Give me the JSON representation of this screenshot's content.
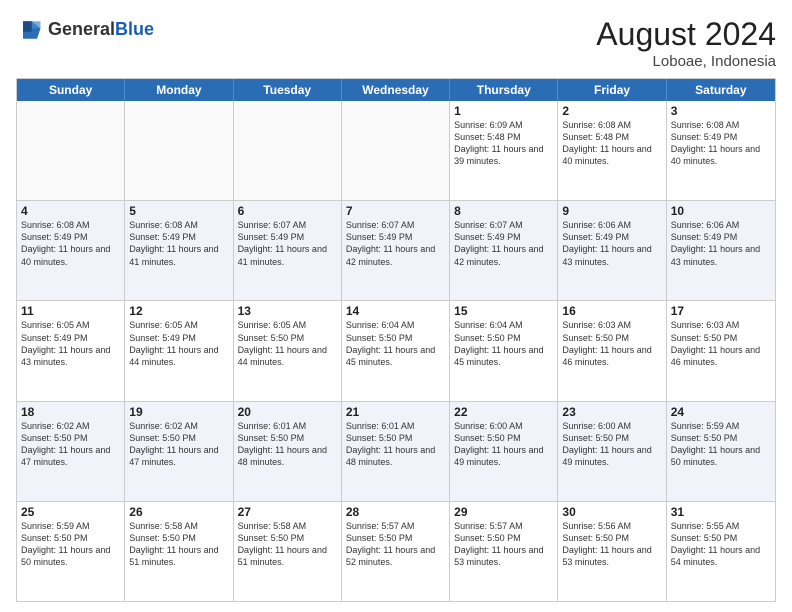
{
  "header": {
    "logo_general": "General",
    "logo_blue": "Blue",
    "month_year": "August 2024",
    "location": "Loboae, Indonesia"
  },
  "days_of_week": [
    "Sunday",
    "Monday",
    "Tuesday",
    "Wednesday",
    "Thursday",
    "Friday",
    "Saturday"
  ],
  "weeks": [
    [
      {
        "day": "",
        "detail": ""
      },
      {
        "day": "",
        "detail": ""
      },
      {
        "day": "",
        "detail": ""
      },
      {
        "day": "",
        "detail": ""
      },
      {
        "day": "1",
        "detail": "Sunrise: 6:09 AM\nSunset: 5:48 PM\nDaylight: 11 hours\nand 39 minutes."
      },
      {
        "day": "2",
        "detail": "Sunrise: 6:08 AM\nSunset: 5:48 PM\nDaylight: 11 hours\nand 40 minutes."
      },
      {
        "day": "3",
        "detail": "Sunrise: 6:08 AM\nSunset: 5:49 PM\nDaylight: 11 hours\nand 40 minutes."
      }
    ],
    [
      {
        "day": "4",
        "detail": "Sunrise: 6:08 AM\nSunset: 5:49 PM\nDaylight: 11 hours\nand 40 minutes."
      },
      {
        "day": "5",
        "detail": "Sunrise: 6:08 AM\nSunset: 5:49 PM\nDaylight: 11 hours\nand 41 minutes."
      },
      {
        "day": "6",
        "detail": "Sunrise: 6:07 AM\nSunset: 5:49 PM\nDaylight: 11 hours\nand 41 minutes."
      },
      {
        "day": "7",
        "detail": "Sunrise: 6:07 AM\nSunset: 5:49 PM\nDaylight: 11 hours\nand 42 minutes."
      },
      {
        "day": "8",
        "detail": "Sunrise: 6:07 AM\nSunset: 5:49 PM\nDaylight: 11 hours\nand 42 minutes."
      },
      {
        "day": "9",
        "detail": "Sunrise: 6:06 AM\nSunset: 5:49 PM\nDaylight: 11 hours\nand 43 minutes."
      },
      {
        "day": "10",
        "detail": "Sunrise: 6:06 AM\nSunset: 5:49 PM\nDaylight: 11 hours\nand 43 minutes."
      }
    ],
    [
      {
        "day": "11",
        "detail": "Sunrise: 6:05 AM\nSunset: 5:49 PM\nDaylight: 11 hours\nand 43 minutes."
      },
      {
        "day": "12",
        "detail": "Sunrise: 6:05 AM\nSunset: 5:49 PM\nDaylight: 11 hours\nand 44 minutes."
      },
      {
        "day": "13",
        "detail": "Sunrise: 6:05 AM\nSunset: 5:50 PM\nDaylight: 11 hours\nand 44 minutes."
      },
      {
        "day": "14",
        "detail": "Sunrise: 6:04 AM\nSunset: 5:50 PM\nDaylight: 11 hours\nand 45 minutes."
      },
      {
        "day": "15",
        "detail": "Sunrise: 6:04 AM\nSunset: 5:50 PM\nDaylight: 11 hours\nand 45 minutes."
      },
      {
        "day": "16",
        "detail": "Sunrise: 6:03 AM\nSunset: 5:50 PM\nDaylight: 11 hours\nand 46 minutes."
      },
      {
        "day": "17",
        "detail": "Sunrise: 6:03 AM\nSunset: 5:50 PM\nDaylight: 11 hours\nand 46 minutes."
      }
    ],
    [
      {
        "day": "18",
        "detail": "Sunrise: 6:02 AM\nSunset: 5:50 PM\nDaylight: 11 hours\nand 47 minutes."
      },
      {
        "day": "19",
        "detail": "Sunrise: 6:02 AM\nSunset: 5:50 PM\nDaylight: 11 hours\nand 47 minutes."
      },
      {
        "day": "20",
        "detail": "Sunrise: 6:01 AM\nSunset: 5:50 PM\nDaylight: 11 hours\nand 48 minutes."
      },
      {
        "day": "21",
        "detail": "Sunrise: 6:01 AM\nSunset: 5:50 PM\nDaylight: 11 hours\nand 48 minutes."
      },
      {
        "day": "22",
        "detail": "Sunrise: 6:00 AM\nSunset: 5:50 PM\nDaylight: 11 hours\nand 49 minutes."
      },
      {
        "day": "23",
        "detail": "Sunrise: 6:00 AM\nSunset: 5:50 PM\nDaylight: 11 hours\nand 49 minutes."
      },
      {
        "day": "24",
        "detail": "Sunrise: 5:59 AM\nSunset: 5:50 PM\nDaylight: 11 hours\nand 50 minutes."
      }
    ],
    [
      {
        "day": "25",
        "detail": "Sunrise: 5:59 AM\nSunset: 5:50 PM\nDaylight: 11 hours\nand 50 minutes."
      },
      {
        "day": "26",
        "detail": "Sunrise: 5:58 AM\nSunset: 5:50 PM\nDaylight: 11 hours\nand 51 minutes."
      },
      {
        "day": "27",
        "detail": "Sunrise: 5:58 AM\nSunset: 5:50 PM\nDaylight: 11 hours\nand 51 minutes."
      },
      {
        "day": "28",
        "detail": "Sunrise: 5:57 AM\nSunset: 5:50 PM\nDaylight: 11 hours\nand 52 minutes."
      },
      {
        "day": "29",
        "detail": "Sunrise: 5:57 AM\nSunset: 5:50 PM\nDaylight: 11 hours\nand 53 minutes."
      },
      {
        "day": "30",
        "detail": "Sunrise: 5:56 AM\nSunset: 5:50 PM\nDaylight: 11 hours\nand 53 minutes."
      },
      {
        "day": "31",
        "detail": "Sunrise: 5:55 AM\nSunset: 5:50 PM\nDaylight: 11 hours\nand 54 minutes."
      }
    ]
  ]
}
